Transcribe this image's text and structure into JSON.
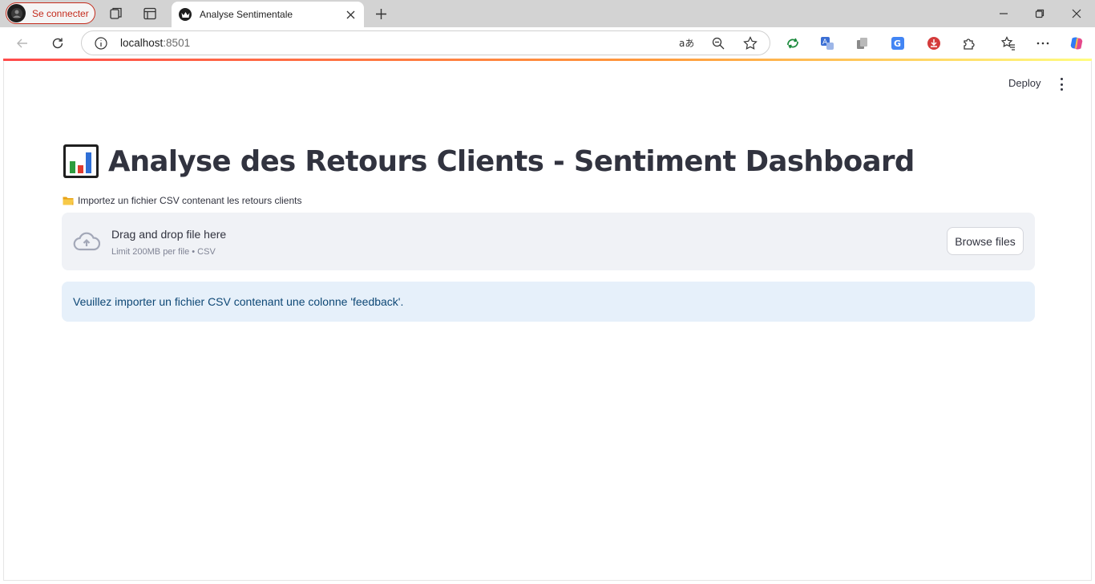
{
  "browser": {
    "profile_label": "Se connecter",
    "tab_title": "Analyse Sentimentale",
    "url_host": "localhost",
    "url_port": ":8501",
    "icons": [
      "workspaces-icon",
      "tab-actions-icon",
      "new-tab-icon",
      "minimize-icon",
      "restore-icon",
      "window-close-icon",
      "back-icon",
      "reload-icon",
      "site-info-icon",
      "read-aloud-icon",
      "zoom-out-icon",
      "favorite-star-icon",
      "extension-icons",
      "favorites-icon",
      "more-icon",
      "copilot-icon"
    ]
  },
  "app": {
    "deploy_label": "Deploy",
    "title": "Analyse des Retours Clients - Sentiment Dashboard",
    "uploader_label": "Importez un fichier CSV contenant les retours clients",
    "dropzone_text": "Drag and drop file here",
    "dropzone_limit": "Limit 200MB per file • CSV",
    "browse_label": "Browse files",
    "info_message": "Veuillez importer un fichier CSV contenant une colonne 'feedback'.",
    "colors": {
      "accent": "#ff4b4b",
      "text": "#31333f",
      "info_bg": "#e6f0fa",
      "info_text": "#0d4775",
      "dropzone_bg": "#f0f2f6"
    }
  }
}
